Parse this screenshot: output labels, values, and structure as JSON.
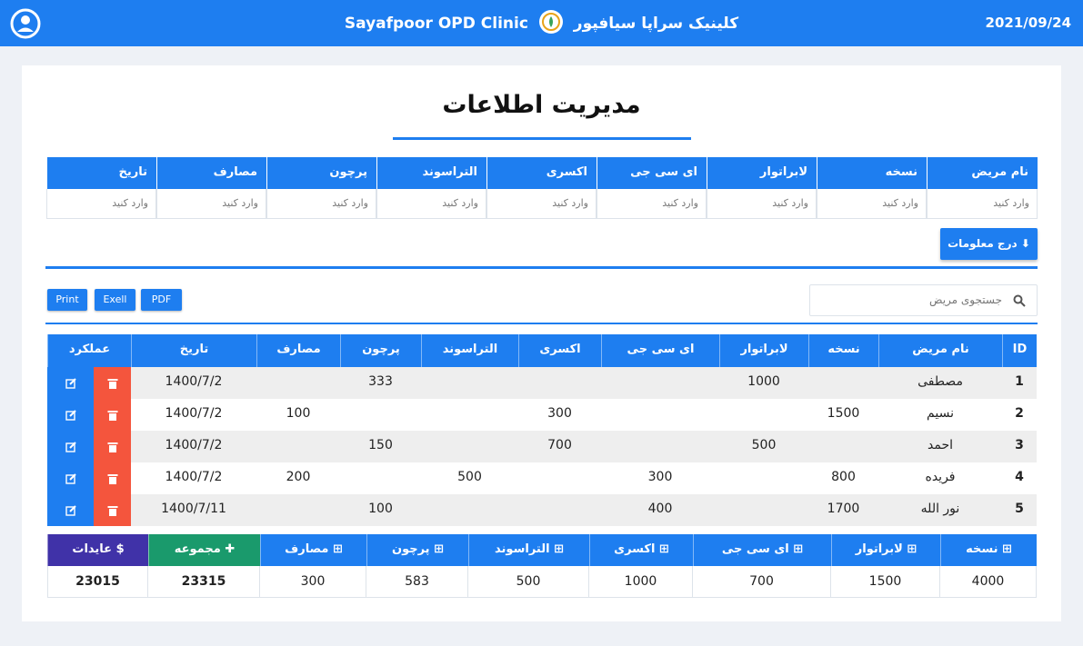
{
  "header": {
    "brand_en": "Sayafpoor OPD Clinic",
    "brand_fa": "کلینیک سراپا سیافپور",
    "date": "2021/09/24",
    "color": "#1e7ef0"
  },
  "page": {
    "title": "مدیریت اطلاعات"
  },
  "entry_form": {
    "columns": [
      "نام مریض",
      "نسخه",
      "لابراتوار",
      "ای سی جی",
      "اکسری",
      "التراسوند",
      "پرچون",
      "مصارف",
      "تاریخ"
    ],
    "placeholder": "وارد کنید",
    "submit_label": "درج معلومات ⬇"
  },
  "toolbar": {
    "print_label": "Print",
    "excel_label": "Exell",
    "pdf_label": "PDF",
    "search_placeholder": "جستجوی مریض"
  },
  "table": {
    "headers": {
      "id": "ID",
      "name": "نام مریض",
      "prescription": "نسخه",
      "lab": "لابراتوار",
      "ecg": "ای سی جی",
      "xray": "اکسری",
      "ultrasound": "التراسوند",
      "retail": "پرچون",
      "expenses": "مصارف",
      "date": "تاریخ",
      "actions": "عملکرد"
    },
    "rows": [
      {
        "id": "1",
        "name": "مصطفی",
        "prescription": "",
        "lab": "1000",
        "ecg": "",
        "xray": "",
        "ultrasound": "",
        "retail": "333",
        "expenses": "",
        "date": "1400/7/2"
      },
      {
        "id": "2",
        "name": "نسیم",
        "prescription": "1500",
        "lab": "",
        "ecg": "",
        "xray": "300",
        "ultrasound": "",
        "retail": "",
        "expenses": "100",
        "date": "1400/7/2"
      },
      {
        "id": "3",
        "name": "احمد",
        "prescription": "",
        "lab": "500",
        "ecg": "",
        "xray": "700",
        "ultrasound": "",
        "retail": "150",
        "expenses": "",
        "date": "1400/7/2"
      },
      {
        "id": "4",
        "name": "فریده",
        "prescription": "800",
        "lab": "",
        "ecg": "300",
        "xray": "",
        "ultrasound": "500",
        "retail": "",
        "expenses": "200",
        "date": "1400/7/2"
      },
      {
        "id": "5",
        "name": "نور الله",
        "prescription": "1700",
        "lab": "",
        "ecg": "400",
        "xray": "",
        "ultrasound": "",
        "retail": "100",
        "expenses": "",
        "date": "1400/7/11"
      }
    ]
  },
  "summary": {
    "headers": {
      "prescription": "نسخه ⊞",
      "lab": "لابراتوار ⊞",
      "ecg": "ای سی جی ⊞",
      "xray": "اکسری ⊞",
      "ultrasound": "التراسوند ⊞",
      "retail": "پرچون ⊞",
      "expenses": "مصارف ⊞",
      "total": "مجموعه ✚",
      "income": "عایدات $"
    },
    "values": {
      "prescription": "4000",
      "lab": "1500",
      "ecg": "700",
      "xray": "1000",
      "ultrasound": "500",
      "retail": "583",
      "expenses": "300",
      "total": "23315",
      "income": "23015"
    },
    "colors": {
      "default": "#1e7ef0",
      "total": "#1a9a6c",
      "income": "#4032a8"
    }
  }
}
